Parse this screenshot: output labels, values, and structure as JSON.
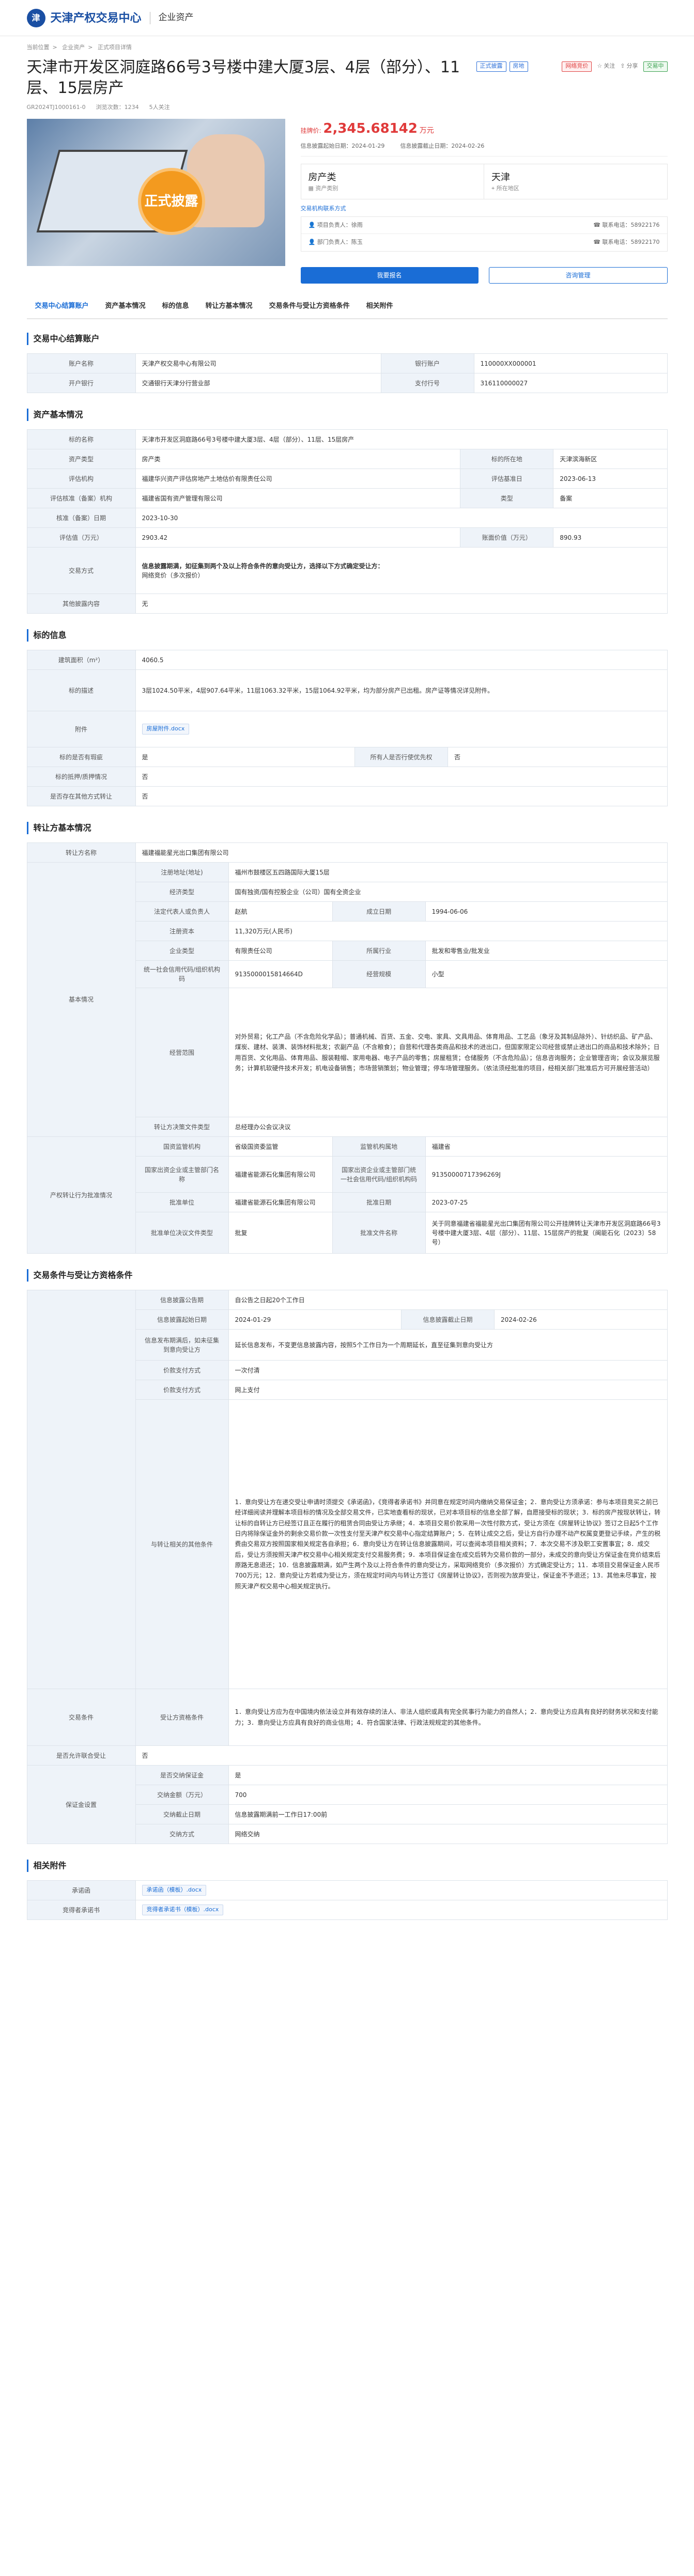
{
  "header": {
    "logo_text": "天津产权交易中心",
    "divider": "|",
    "sub": "企业资产"
  },
  "breadcrumb": [
    "当前位置",
    "企业资产",
    "正式项目详情"
  ],
  "title": "天津市开发区洞庭路66号3号楼中建大厦3层、4层（部分）、11层、15层房产",
  "tags": [
    "正式披露",
    "房地",
    "网络竞价",
    "交易中"
  ],
  "actions": {
    "follow": "关注",
    "share": "分享"
  },
  "subinfo": {
    "code": "GR2024TJ1000161-0",
    "views": "浏览次数：1234",
    "follows": "5人关注"
  },
  "hero_badge": "正式披露",
  "price": {
    "label": "挂牌价:",
    "value": "2,345.68142",
    "unit": "万元"
  },
  "dates": {
    "start": "信息披露起始日期：2024-01-29",
    "end": "信息披露截止日期：2024-02-26"
  },
  "cards": [
    {
      "big": "房产类",
      "small": "资产类别"
    },
    {
      "big": "天津",
      "small": "所在地区"
    }
  ],
  "org_link": "交易机构联系方式",
  "contacts": [
    {
      "left": "项目负责人：徐雨",
      "right": "联系电话：58922176"
    },
    {
      "left": "部门负责人：陈玉",
      "right": "联系电话：58922170"
    }
  ],
  "buttons": {
    "signup": "我要报名",
    "consult": "咨询管理"
  },
  "tabs": [
    "交易中心结算账户",
    "资产基本情况",
    "标的信息",
    "转让方基本情况",
    "交易条件与受让方资格条件",
    "相关附件"
  ],
  "account": {
    "section": "交易中心结算账户",
    "rows": [
      [
        "账户名称",
        "天津产权交易中心有限公司",
        "银行账户",
        "110000XX000001"
      ],
      [
        "开户银行",
        "交通银行天津分行营业部",
        "支付行号",
        "316110000027"
      ]
    ]
  },
  "asset": {
    "section": "资产基本情况",
    "name_label": "标的名称",
    "name": "天津市开发区洞庭路66号3号楼中建大厦3层、4层（部分）、11层、15层房产",
    "rows": [
      [
        "资产类型",
        "房产类",
        "标的所在地",
        "天津滨海新区"
      ],
      [
        "评估机构",
        "福建华兴资产评估房地产土地估价有限责任公司",
        "评估基准日",
        "2023-06-13"
      ],
      [
        "评估核准（备案）机构",
        "福建省国有资产管理有限公司",
        "类型",
        "备案"
      ]
    ],
    "date_label": "核准（备案）日期",
    "date": "2023-10-30",
    "value_label": "评估值（万元）",
    "value": "2903.42",
    "book_label": "账面价值（万元）",
    "book": "890.93",
    "method_label": "交易方式",
    "method_main": "信息披露期满，如征集到两个及以上符合条件的意向受让方，选择以下方式确定受让方：",
    "method_sub": "网络竞价（多次报价）",
    "other_label": "其他披露内容",
    "other": "无"
  },
  "subject": {
    "section": "标的信息",
    "rows": [
      [
        "建筑面积（m²）",
        "4060.5"
      ],
      [
        "标的描述",
        "3层1024.50平米，4层907.64平米，11层1063.32平米，15层1064.92平米，均为部分房产已出租。房产证等情况详见附件。"
      ]
    ],
    "attach_label": "附件",
    "attach": "房屋附件.docx",
    "rows2": [
      [
        "标的是否有瑕疵",
        "是",
        "所有人是否行使优先权",
        "否"
      ]
    ],
    "rows3": [
      [
        "标的抵押/质押情况",
        "否"
      ],
      [
        "是否存在其他方式转让",
        "否"
      ]
    ]
  },
  "transferor": {
    "section": "转让方基本情况",
    "name_label": "转让方名称",
    "name": "福建福能星光出口集团有限公司",
    "basic_label": "基本情况",
    "rows": [
      [
        "注册地址(地址)",
        "福州市鼓楼区五四路国际大厦15层"
      ],
      [
        "经济类型",
        "国有独资/国有控股企业（公司）国有全资企业"
      ]
    ],
    "legal": [
      "法定代表人或负责人",
      "赵航",
      "成立日期",
      "1994-06-06"
    ],
    "capital": [
      "注册资本",
      "11,320万元(人民币)"
    ],
    "type": [
      "企业类型",
      "有限责任公司",
      "所属行业",
      "批发和零售业/批发业"
    ],
    "credit": [
      "统一社会信用代码/组织机构码",
      "9135000015814664D",
      "经营规模",
      "小型"
    ],
    "scope_label": "经营范围",
    "scope": "对外贸易；化工产品（不含危险化学品）；普通机械、百货、五金、交电、家具、文具用品、体育用品、工艺品（象牙及其制品除外）、针纺织品、矿产品、煤炭、建材、装潢、装饰材料批发；农副产品（不含粮食）；自营和代理各类商品和技术的进出口，但国家限定公司经营或禁止进出口的商品和技术除外；日用百货、文化用品、体育用品、服装鞋帽、家用电器、电子产品的零售；房屋租赁；仓储服务（不含危险品）；信息咨询服务；企业管理咨询；会议及展览服务；计算机软硬件技术开发；机电设备销售；市场营销策划；物业管理；停车场管理服务。（依法须经批准的项目，经相关部门批准后方可开展经营活动）",
    "decision_label": "转让方决策文件类型",
    "decision": "总经理办公会议决议",
    "approval_label": "产权转让行为批准情况",
    "app_rows": [
      [
        "国资监管机构",
        "省级国资委监管",
        "监管机构属地",
        "福建省"
      ],
      [
        "国家出资企业或主管部门名称",
        "福建省能源石化集团有限公司",
        "国家出资企业或主管部门统一社会信用代码/组织机构码",
        "91350000717396269J"
      ],
      [
        "批准单位",
        "福建省能源石化集团有限公司",
        "批准日期",
        "2023-07-25"
      ],
      [
        "批准单位决议文件类型",
        "批复",
        "批准文件名称",
        "关于同意福建省福能星光出口集团有限公司公开挂牌转让天津市开发区洞庭路66号3号楼中建大厦3层、4层（部分）、11层、15层房产的批复（闽能石化〔2023〕58号）"
      ]
    ]
  },
  "conditions": {
    "section": "交易条件与受让方资格条件",
    "dates": [
      [
        "信息披露公告期",
        "自公告之日起20个工作日"
      ],
      [
        "信息披露起始日期",
        "2024-01-29",
        "信息披露截止日期",
        "2024-02-26"
      ]
    ],
    "delay_label": "信息发布期满后，如未征集到意向受让方",
    "delay": "延长信息发布，不变更信息披露内容，按照5个工作日为一个周期延长，直至征集到意向受让方",
    "pay_label": "价款支付方式",
    "pay": "一次付清",
    "method_label": "价款支付方式",
    "method": "网上支付",
    "trade_label": "交易条件",
    "cond_label": "与转让相关的其他条件",
    "cond": "1．意向受让方在递交受让申请时须提交《承诺函》，《竞得者承诺书》并同意在规定时间内缴纳交易保证金；2．意向受让方须承诺：参与本项目竞买之前已经详细阅读并理解本项目标的情况及全部交易文件，已实地查看标的现状，已对本项目标的信息全部了解，自愿接受标的现状；3．标的房产按现状转让，转让标的自转让方已经签订且正在履行的租赁合同由受让方承继；4．本项目交易价款采用一次性付款方式，受让方须在《房屋转让协议》签订之日起5个工作日内将除保证金外的剩余交易价款一次性支付至天津产权交易中心指定结算账户；5．在转让成交之后，受让方自行办理不动产权属变更登记手续，产生的税费由交易双方按照国家相关规定各自承担；6．意向受让方在转让信息披露期间，可以查阅本项目相关资料；7．本次交易不涉及职工安置事宜；8．成交后，受让方须按照天津产权交易中心相关规定支付交易服务费；9．本项目保证金在成交后转为交易价款的一部分，未成交的意向受让方保证金在竞价结束后原路无息退还；10．信息披露期满，如产生两个及以上符合条件的意向受让方，采取网络竞价（多次报价）方式确定受让方；11．本项目交易保证金人民币700万元；12．意向受让方若成为受让方，须在规定时间内与转让方签订《房屋转让协议》，否则视为放弃受让，保证金不予退还；13．其他未尽事宜，按照天津产权交易中心相关规定执行。",
    "qual_label": "受让方资格条件",
    "qual": "1．意向受让方应为在中国境内依法设立并有效存续的法人、非法人组织或具有完全民事行为能力的自然人；2．意向受让方应具有良好的财务状况和支付能力；3．意向受让方应具有良好的商业信用；4．符合国家法律、行政法规规定的其他条件。",
    "joint_label": "是否允许联合受让",
    "joint": "否",
    "deposit_label": "保证金设置",
    "deposit_rows": [
      [
        "是否交纳保证金",
        "是"
      ],
      [
        "交纳金额（万元）",
        "700"
      ],
      [
        "交纳截止日期",
        "信息披露期满前一工作日17:00前"
      ],
      [
        "交纳方式",
        "网络交纳"
      ]
    ]
  },
  "attachments": {
    "section": "相关附件",
    "rows": [
      [
        "承诺函",
        "承诺函（模板）.docx"
      ],
      [
        "竞得者承诺书",
        "竞得者承诺书（模板）.docx"
      ]
    ]
  }
}
